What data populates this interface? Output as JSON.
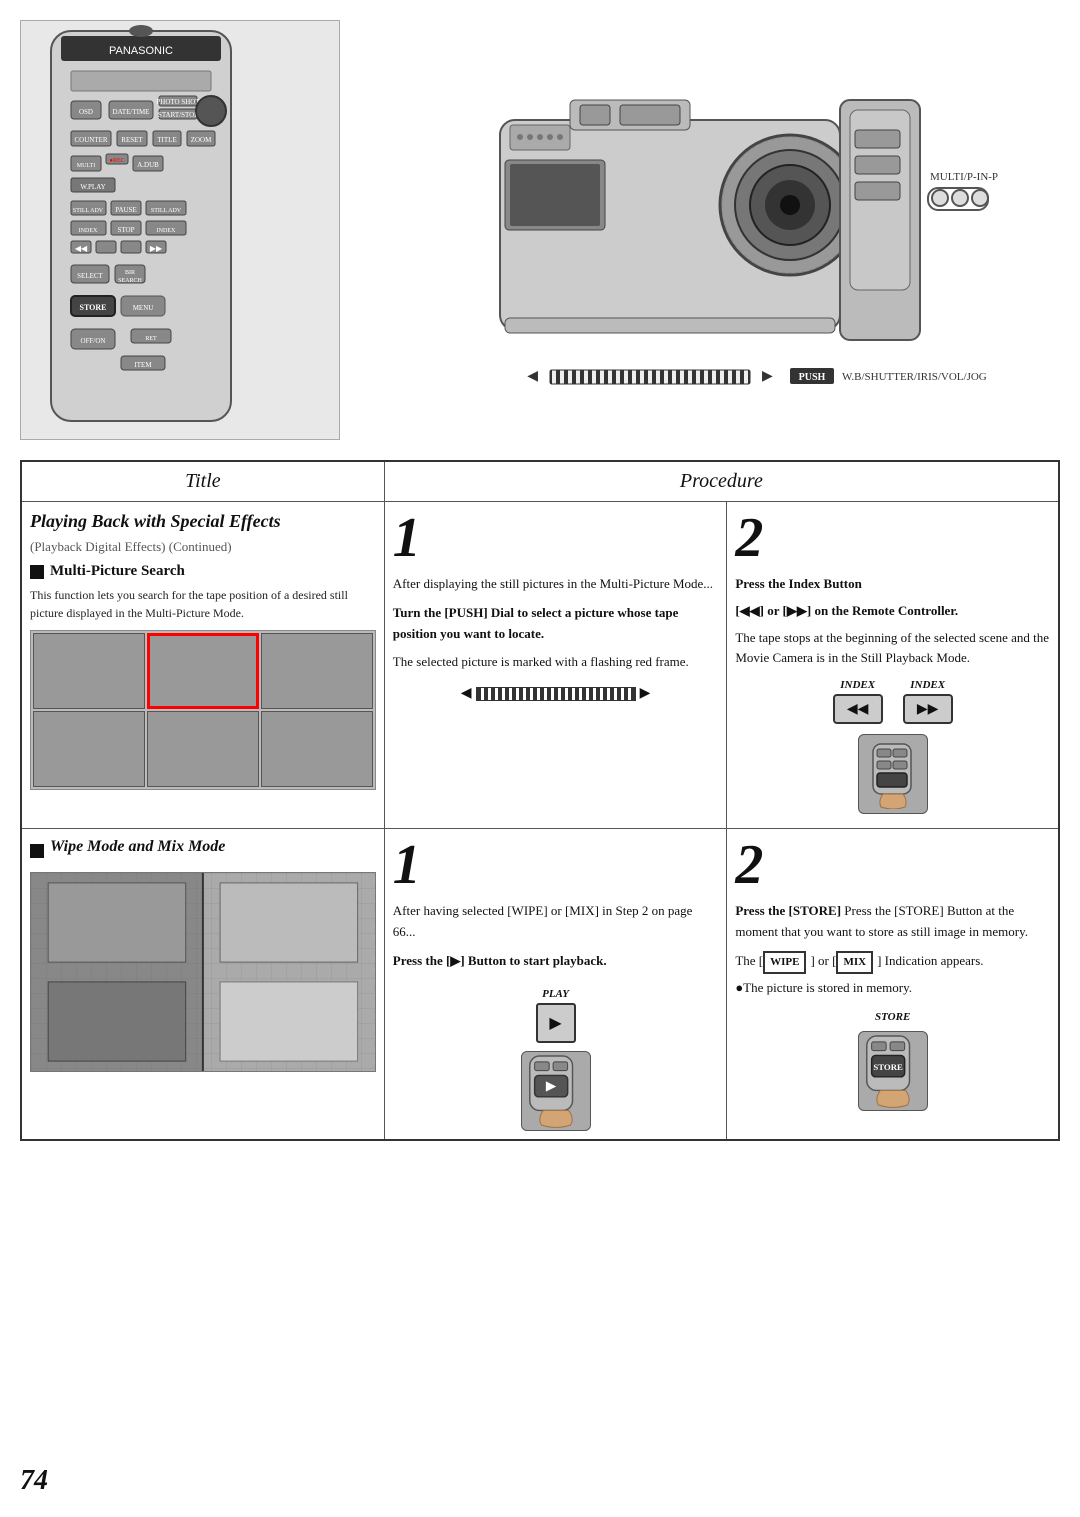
{
  "page": {
    "number": "74",
    "background": "#fff"
  },
  "top_section": {
    "camera_label": "MULTI/P-IN-P",
    "push_label": "PUSH",
    "push_description": "W.B/SHUTTER/IRIS/VOL/JOG"
  },
  "table": {
    "header": {
      "title_col": "Title",
      "procedure_col": "Procedure"
    },
    "row1": {
      "title": {
        "main_title": "Playing Back with Special Effects",
        "subtitle": "(Playback Digital Effects) (Continued)",
        "subsection": "Multi-Picture Search",
        "description": "This function lets you search for the tape position of a desired still picture displayed in the Multi-Picture Mode."
      },
      "step1": {
        "number": "1",
        "text1": "After displaying the still pictures in the Multi-Picture Mode...",
        "text2": "Turn the [PUSH] Dial to select a picture whose tape position you want to locate.",
        "text3": "The selected picture is marked with a flashing red frame."
      },
      "step2": {
        "number": "2",
        "text1": "Press the Index Button",
        "text2": "[",
        "text3": "] or [",
        "text4": "] on the Remote Controller.",
        "text5": "The tape stops at the beginning of the selected scene and the Movie Camera is in the Still Playback Mode.",
        "index_left_label": "INDEX",
        "index_right_label": "INDEX",
        "index_left_symbol": "◀◀",
        "index_right_symbol": "▶▶"
      }
    },
    "row2": {
      "title": {
        "subsection": "Wipe Mode and Mix Mode"
      },
      "step1": {
        "number": "1",
        "text1": "After having selected [WIPE] or [MIX] in Step 2 on page 66...",
        "text2": "Press the [▶] Button to start playback.",
        "play_label": "PLAY"
      },
      "step2": {
        "number": "2",
        "text1": "Press the [STORE] Button at the moment that you want to store as still image in memory.",
        "text2": "The [WIPE] or [MIX] Indication appears.",
        "text3": "●The picture is stored in memory.",
        "store_label": "STORE"
      }
    }
  }
}
